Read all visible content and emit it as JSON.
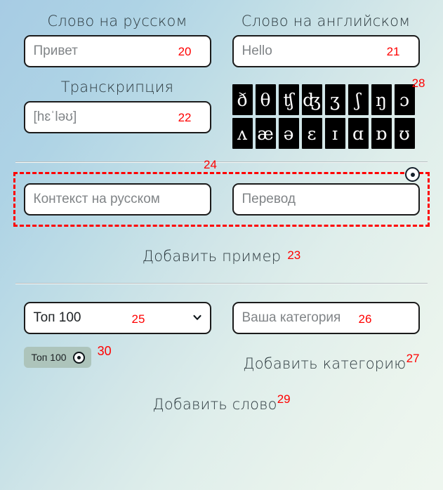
{
  "colors": {
    "annotation": "#ff0000",
    "label_text": "#2d3a3f",
    "input_border": "#1b1b1b",
    "input_bg": "#ffffff",
    "ipa_key_bg": "#000000",
    "ipa_key_text": "#ffffff",
    "chip_bg": "#adc4bb",
    "divider": "#b8bfc2",
    "bg_start": "#a7cce4",
    "bg_end": "#eef6ef"
  },
  "word_section": {
    "russian": {
      "label": "Слово на русском",
      "placeholder": "Привет",
      "value": "",
      "annotation": "20"
    },
    "english": {
      "label": "Слово на английском",
      "placeholder": "Hello",
      "value": "",
      "annotation": "21"
    }
  },
  "transcription_section": {
    "label": "Транскрипция",
    "placeholder": "[hɛˈləʊ]",
    "value": "",
    "annotation": "22"
  },
  "ipa_keyboard": {
    "annotation": "28",
    "row1": [
      "ð",
      "θ",
      "ʧ",
      "ʤ",
      "ʒ",
      "ʃ",
      "ŋ",
      "ɔ"
    ],
    "row2": [
      "ʌ",
      "æ",
      "ə",
      "ɛ",
      "ɪ",
      "ɑ",
      "ɒ",
      "ʊ"
    ]
  },
  "example_section": {
    "annotation": "24",
    "remove_icon": "remove-circle-icon",
    "context": {
      "placeholder": "Контекст на русском",
      "value": ""
    },
    "translation": {
      "placeholder": "Перевод",
      "value": ""
    }
  },
  "add_example": {
    "label": "Добавить пример",
    "annotation": "23"
  },
  "category_section": {
    "select": {
      "selected": "Топ 100",
      "annotation": "25",
      "icon": "chevron-down-icon",
      "options": [
        "Топ 100"
      ]
    },
    "custom_category": {
      "placeholder": "Ваша категория",
      "value": "",
      "annotation": "26"
    },
    "chip": {
      "label": "Топ 100",
      "annotation": "30",
      "remove_icon": "remove-circle-icon"
    },
    "add_category": {
      "label": "Добавить категорию",
      "annotation": "27"
    }
  },
  "submit": {
    "label": "Добавить слово",
    "annotation": "29"
  }
}
